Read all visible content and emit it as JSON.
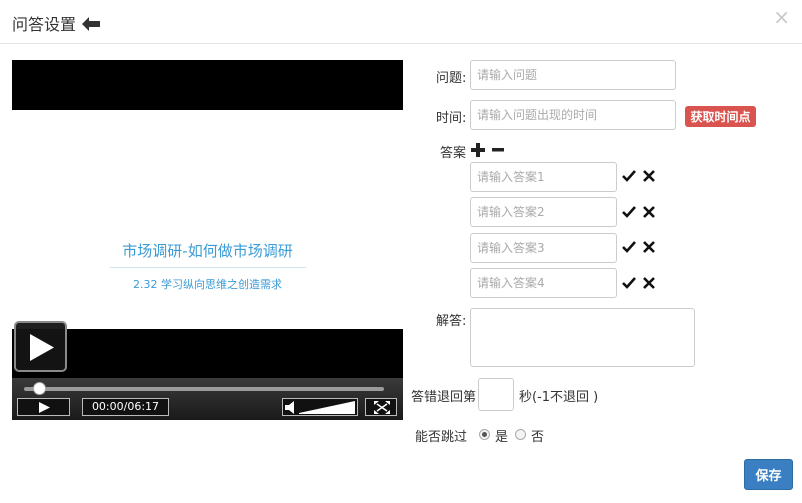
{
  "dialog": {
    "title": "问答设置",
    "close_label": "×",
    "icons": {
      "back": "arrow-left-icon",
      "close": "close-icon"
    }
  },
  "player": {
    "slide_title": "市场调研-如何做市场调研",
    "slide_subtitle": "2.32 学习纵向思维之创造需求",
    "time_display": "00:00/06:17",
    "progress_fraction": 0,
    "icons": {
      "play": "play-icon",
      "volume": "volume-icon",
      "fullscreen": "fullscreen-icon"
    }
  },
  "form": {
    "question": {
      "label": "问题:",
      "placeholder": "请输入问题"
    },
    "time": {
      "label": "时间:",
      "placeholder": "请输入问题出现的时间",
      "button": "获取时间点"
    },
    "answers_label": "答案",
    "answers": [
      {
        "placeholder": "请输入答案1"
      },
      {
        "placeholder": "请输入答案2"
      },
      {
        "placeholder": "请输入答案3"
      },
      {
        "placeholder": "请输入答案4"
      }
    ],
    "explanation": {
      "label": "解答:"
    },
    "retreat": {
      "label": "答错退回第",
      "suffix": "秒(-1不退回 )"
    },
    "skip": {
      "label": "能否跳过",
      "yes": "是",
      "no": "否",
      "selected": "是"
    },
    "save_button": "保存",
    "icons": {
      "add": "plus-icon",
      "remove": "minus-icon",
      "correct": "check-icon",
      "delete": "x-icon"
    }
  }
}
